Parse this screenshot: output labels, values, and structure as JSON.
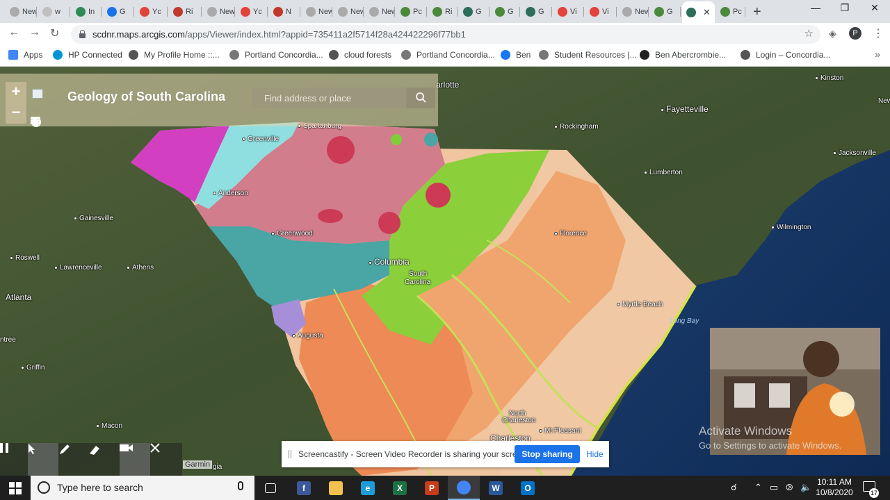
{
  "tabs": [
    {
      "label": "New T",
      "color": "#aaaaaa"
    },
    {
      "label": "w",
      "color": "#c0c0c0"
    },
    {
      "label": "In",
      "color": "#2e8b57"
    },
    {
      "label": "G",
      "color": "#1a73e8"
    },
    {
      "label": "Yc",
      "color": "#e0443c"
    },
    {
      "label": "Ri",
      "color": "#c0392b"
    },
    {
      "label": "New T",
      "color": "#aaaaaa"
    },
    {
      "label": "Yc",
      "color": "#e0443c"
    },
    {
      "label": "N",
      "color": "#c0392b"
    },
    {
      "label": "New T",
      "color": "#aaaaaa"
    },
    {
      "label": "New T",
      "color": "#aaaaaa"
    },
    {
      "label": "New T",
      "color": "#aaaaaa"
    },
    {
      "label": "Pc",
      "color": "#4a8a3a"
    },
    {
      "label": "Ri",
      "color": "#4a8a3a"
    },
    {
      "label": "G",
      "color": "#2c6e5a"
    },
    {
      "label": "G",
      "color": "#4a8a3a"
    },
    {
      "label": "G",
      "color": "#2c6e5a"
    },
    {
      "label": "Vi",
      "color": "#e0443c"
    },
    {
      "label": "Vi",
      "color": "#e0443c"
    },
    {
      "label": "New T",
      "color": "#aaaaaa"
    },
    {
      "label": "G",
      "color": "#4a8a3a"
    },
    {
      "label": "",
      "color": "#2c6e5a",
      "active": true
    },
    {
      "label": "Pc",
      "color": "#4a8a3a"
    }
  ],
  "omnibox": {
    "host": "scdnr.maps.arcgis.com",
    "path": "/apps/Viewer/index.html?appid=735411a2f5714f28a424422296f77bb1"
  },
  "profile_initial": "P",
  "bookmarks": [
    {
      "label": "Apps",
      "icon": "apps-grid",
      "color": "#4285f4"
    },
    {
      "label": "HP Connected",
      "icon": "hp-logo",
      "color": "#0096d6"
    },
    {
      "label": "My Profile Home ::...",
      "icon": "globe",
      "color": "#555555"
    },
    {
      "label": "Portland Concordia...",
      "icon": "shield",
      "color": "#777777"
    },
    {
      "label": "cloud forests",
      "icon": "globe",
      "color": "#555555"
    },
    {
      "label": "Portland Concordia...",
      "icon": "shield",
      "color": "#777777"
    },
    {
      "label": "Ben",
      "icon": "facebook",
      "color": "#1877f2"
    },
    {
      "label": "Student Resources |...",
      "icon": "shield",
      "color": "#777777"
    },
    {
      "label": "Ben Abercrombie...",
      "icon": "bb",
      "color": "#222222"
    },
    {
      "label": "Login – Concordia...",
      "icon": "globe",
      "color": "#555555"
    }
  ],
  "map": {
    "title": "Geology of South Carolina",
    "search_placeholder": "Find address or place",
    "attribution": "Garmin",
    "cities": [
      {
        "name": "arlotte",
        "big": true
      },
      {
        "name": "Fayetteville",
        "big": true
      },
      {
        "name": "Kinston"
      },
      {
        "name": "New"
      },
      {
        "name": "Rockingham"
      },
      {
        "name": "Jacksonville"
      },
      {
        "name": "Greenville"
      },
      {
        "name": "Spartanburg"
      },
      {
        "name": "Lumberton"
      },
      {
        "name": "Anderson"
      },
      {
        "name": "Gainesville"
      },
      {
        "name": "Wilmington"
      },
      {
        "name": "Greenwood"
      },
      {
        "name": "Florence"
      },
      {
        "name": "Roswell"
      },
      {
        "name": "Columbia",
        "big": true
      },
      {
        "name": "Lawrenceville"
      },
      {
        "name": "Athens"
      },
      {
        "name": "South"
      },
      {
        "name": "Carolina"
      },
      {
        "name": "Atlanta",
        "big": true
      },
      {
        "name": "Myrtle Beach"
      },
      {
        "name": "Augusta"
      },
      {
        "name": "ntree"
      },
      {
        "name": "Griffin"
      },
      {
        "name": "North"
      },
      {
        "name": "Charleston"
      },
      {
        "name": "Macon"
      },
      {
        "name": "Charleston",
        "big": true
      },
      {
        "name": "Mt Pleasant"
      },
      {
        "name": "gia"
      }
    ],
    "water_label": "Long Bay"
  },
  "activate_windows": {
    "line1": "Activate Windows",
    "line2": "Go to Settings to activate Windows."
  },
  "screen_share": {
    "message": "Screencastify - Screen Video Recorder is sharing your screen.",
    "stop_label": "Stop sharing",
    "hide_label": "Hide"
  },
  "taskbar": {
    "search_placeholder": "Type here to search",
    "time": "10:11 AM",
    "date": "10/8/2020",
    "notification_count": "17",
    "apps": [
      {
        "name": "task-view",
        "glyph": "",
        "color": "#1f1f1f"
      },
      {
        "name": "facebook-app",
        "glyph": "f",
        "color": "#3b5998"
      },
      {
        "name": "file-explorer",
        "glyph": "",
        "color": "#f2c14e"
      },
      {
        "name": "edge",
        "glyph": "e",
        "color": "#1f9bd8"
      },
      {
        "name": "excel",
        "glyph": "X",
        "color": "#1d7044"
      },
      {
        "name": "powerpoint",
        "glyph": "P",
        "color": "#c43e1c"
      },
      {
        "name": "chrome",
        "glyph": "",
        "color": "#4285f4",
        "active": true
      },
      {
        "name": "word",
        "glyph": "W",
        "color": "#2b579a"
      },
      {
        "name": "outlook",
        "glyph": "O",
        "color": "#0072c6"
      }
    ]
  }
}
